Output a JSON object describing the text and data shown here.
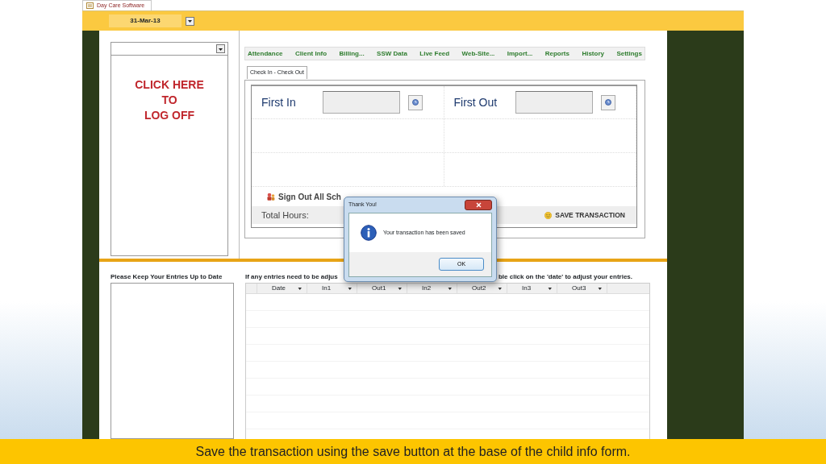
{
  "window": {
    "tab": "Day Care Software"
  },
  "date_field": {
    "value": "31-Mar-13"
  },
  "logoff": {
    "lines": [
      "CLICK HERE",
      "TO",
      "LOG OFF"
    ]
  },
  "tabs": [
    "Attendance",
    "Client Info",
    "Billing...",
    "SSW Data",
    "Live Feed",
    "Web-Site...",
    "Import...",
    "Reports",
    "History",
    "Settings"
  ],
  "subtabs": [
    {
      "label": "Check In - Check Out",
      "selected": true
    }
  ],
  "check_in": {
    "first_in": "First In",
    "first_out": "First Out",
    "sign_out": "Sign Out All Sch",
    "total_hours": "Total Hours:",
    "save": "SAVE TRANSACTION"
  },
  "bottom": {
    "left_title": "Please Keep Your Entries Up to Date",
    "note_left": "If any entries need to be adjus",
    "note_right": "ble click on the 'date' to adjust your entries.",
    "columns": [
      "Date",
      "In1",
      "Out1",
      "In2",
      "Out2",
      "In3",
      "Out3"
    ]
  },
  "dialog": {
    "title": "Thank You!",
    "message": "Your transaction has been saved",
    "button": "OK"
  },
  "caption": "Save the transaction using the save button at the base of the child info form."
}
